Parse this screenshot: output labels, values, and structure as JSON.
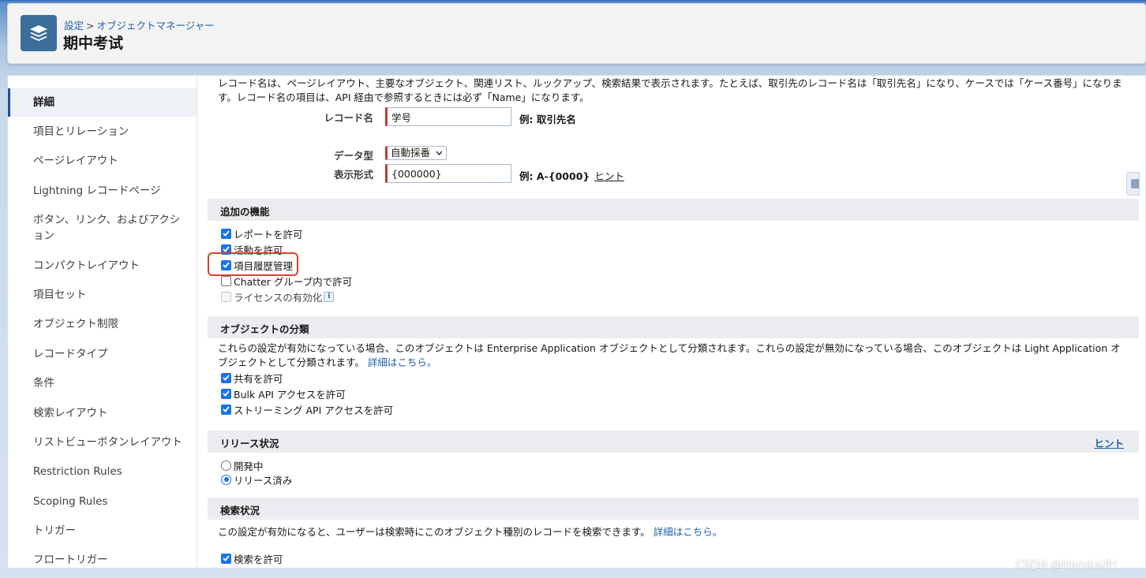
{
  "header": {
    "breadcrumb_setup": "設定",
    "breadcrumb_sep": ">",
    "breadcrumb_object_manager": "オブジェクトマネージャー",
    "title": "期中考试",
    "icon": "layers-icon"
  },
  "sidebar": {
    "items": [
      {
        "label": "詳細",
        "active": true
      },
      {
        "label": "項目とリレーション"
      },
      {
        "label": "ページレイアウト"
      },
      {
        "label": "Lightning レコードページ"
      },
      {
        "label": "ボタン、リンク、およびアクション"
      },
      {
        "label": "コンパクトレイアウト"
      },
      {
        "label": "項目セット"
      },
      {
        "label": "オブジェクト制限"
      },
      {
        "label": "レコードタイプ"
      },
      {
        "label": "条件"
      },
      {
        "label": "検索レイアウト"
      },
      {
        "label": "リストビューボタンレイアウト"
      },
      {
        "label": "Restriction Rules"
      },
      {
        "label": "Scoping Rules"
      },
      {
        "label": "トリガー"
      },
      {
        "label": "フロートリガー"
      }
    ]
  },
  "record_name": {
    "intro": "レコード名は、ページレイアウト、主要なオブジェクト、関連リスト、ルックアップ、検索結果で表示されます。たとえば、取引先のレコード名は「取引先名」になり、ケースでは「ケース番号」になります。レコード名の項目は、API 経由で参照するときには必ず「Name」になります。",
    "name_label": "レコード名",
    "name_value": "学号",
    "name_example": "例:  取引先名",
    "datatype_label": "データ型",
    "datatype_value": "自動採番",
    "format_label": "表示形式",
    "format_value": "{000000}",
    "format_example": "例:  A-{0000}",
    "format_hint": "ヒント"
  },
  "additional_features": {
    "title": "追加の機能",
    "options": [
      {
        "label": "レポートを許可",
        "checked": true
      },
      {
        "label": "活動を許可",
        "checked": true
      },
      {
        "label": "項目履歴管理",
        "checked": true
      },
      {
        "label": "Chatter グループ内で許可",
        "checked": false
      },
      {
        "label": "ライセンスの有効化",
        "checked": false,
        "disabled": true
      }
    ],
    "info_icon": "i"
  },
  "object_classification": {
    "title": "オブジェクトの分類",
    "description": "これらの設定が有効になっている場合、このオブジェクトは Enterprise Application オブジェクトとして分類されます。これらの設定が無効になっている場合、このオブジェクトは Light Application オブジェクトとして分類されます。",
    "learn_more": "詳細はこちら。",
    "options": [
      {
        "label": "共有を許可",
        "checked": true
      },
      {
        "label": "Bulk API アクセスを許可",
        "checked": true
      },
      {
        "label": "ストリーミング API アクセスを許可",
        "checked": true
      }
    ]
  },
  "deployment_status": {
    "title": "リリース状況",
    "hint": "ヒント",
    "options": [
      {
        "label": "開発中",
        "selected": false
      },
      {
        "label": "リリース済み",
        "selected": true
      }
    ]
  },
  "search_status": {
    "title": "検索状況",
    "description": "この設定が有効になると、ユーザーは検索時にこのオブジェクト種別のレコードを検索できます。",
    "learn_more": "詳細はこちら。",
    "options": [
      {
        "label": "検索を許可",
        "checked": true
      }
    ]
  },
  "watermark": "CSDN @Haruka冲！",
  "colors": {
    "accent": "#1b5297",
    "link": "#1f5fa8",
    "required": "#c23934",
    "highlight": "#d9412b",
    "checkbox": "#1a73e8"
  }
}
